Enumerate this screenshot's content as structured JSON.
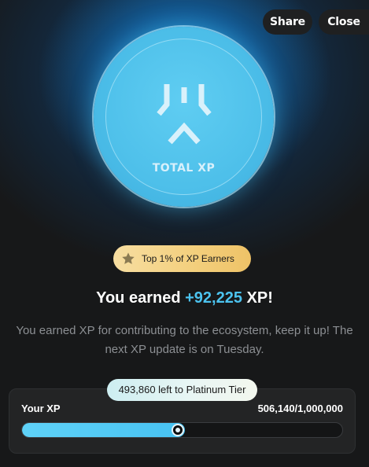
{
  "header": {
    "share_label": "Share",
    "close_label": "Close"
  },
  "coin": {
    "label": "TOTAL XP",
    "logo_icon": "xp-logo-icon"
  },
  "badge": {
    "icon": "star-icon",
    "text": "Top 1% of XP Earners"
  },
  "summary": {
    "prefix": "You earned ",
    "amount": "+92,225",
    "suffix": " XP!",
    "description_line1": "You earned XP for contributing to the ecosystem, keep it up! The",
    "description_line2": "next XP update is on Tuesday."
  },
  "progress": {
    "tier_text": "493,860 left to Platinum Tier",
    "label": "Your XP",
    "value_text": "506,140/1,000,000",
    "fraction": 0.50614
  },
  "colors": {
    "accent": "#4cc3ef",
    "badge_gold": "#f3cf7c",
    "background": "#171819"
  }
}
